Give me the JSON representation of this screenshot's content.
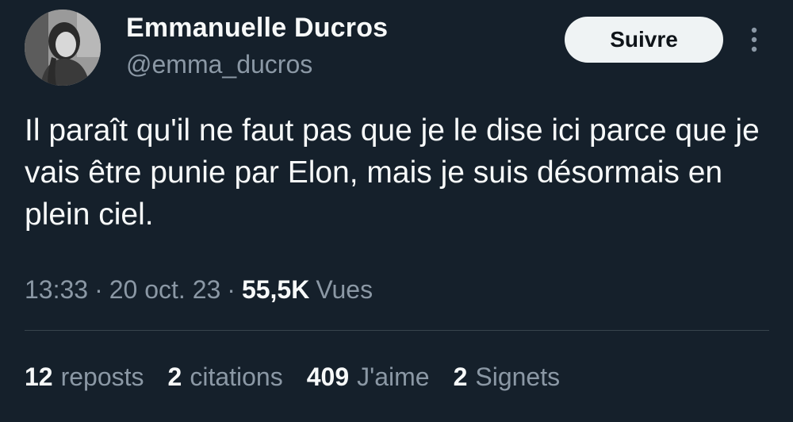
{
  "author": {
    "display_name": "Emmanuelle Ducros",
    "handle": "@emma_ducros",
    "follow_label": "Suivre"
  },
  "tweet": {
    "text": "Il paraît qu'il ne faut pas que je le dise ici parce que je vais être punie par Elon, mais je suis désormais en plein ciel.",
    "time": "13:33",
    "date": "20 oct. 23",
    "separator": "·",
    "views_count": "55,5K",
    "views_label": "Vues"
  },
  "stats": {
    "reposts_count": "12",
    "reposts_label": "reposts",
    "quotes_count": "2",
    "quotes_label": "citations",
    "likes_count": "409",
    "likes_label": "J'aime",
    "bookmarks_count": "2",
    "bookmarks_label": "Signets"
  },
  "colors": {
    "background": "#15202b",
    "primary_text": "#f7f9f9",
    "secondary_text": "#8b98a5",
    "button_bg": "#eff3f4",
    "divider": "#38444d"
  },
  "icons": {
    "more": "more-vertical-icon"
  }
}
